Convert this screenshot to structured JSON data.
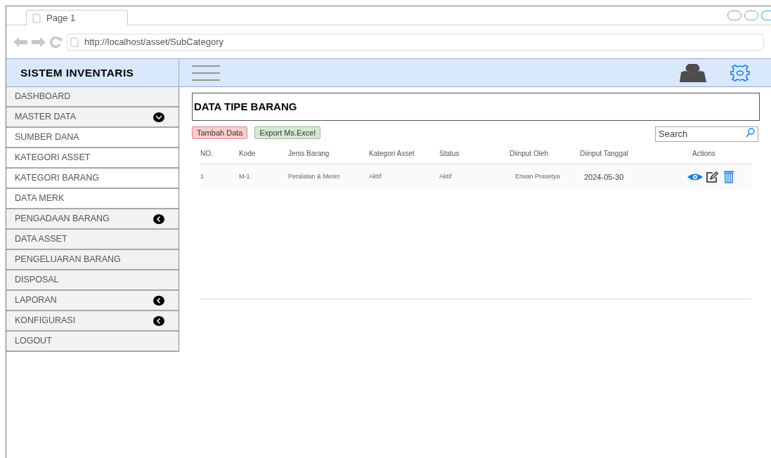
{
  "browser": {
    "tab": "Page 1",
    "url": "http://localhost/asset/SubCategory"
  },
  "app_title": "SISTEM INVENTARIS",
  "sidebar": {
    "items": [
      {
        "label": "DASHBOARD"
      },
      {
        "label": "MASTER DATA",
        "expanded": true,
        "children": [
          {
            "label": "SUMBER DANA"
          },
          {
            "label": "KATEGORI ASSET"
          },
          {
            "label": "KATEGORI BARANG"
          },
          {
            "label": "DATA MERK"
          }
        ]
      },
      {
        "label": "PENGADAAN BARANG",
        "expanded": false
      },
      {
        "label": "DATA ASSET"
      },
      {
        "label": "PENGELUARAN BARANG"
      },
      {
        "label": "DISPOSAL"
      },
      {
        "label": "LAPORAN",
        "expanded": false
      },
      {
        "label": "KONFIGURASI",
        "expanded": false
      },
      {
        "label": "LOGOUT"
      }
    ]
  },
  "page_title": "DATA TIPE BARANG",
  "buttons": [
    {
      "label": "Tambah Data",
      "kind": "add"
    },
    {
      "label": "Export Ms.Excel",
      "kind": "export"
    }
  ],
  "search": {
    "placeholder": "Search"
  },
  "table": {
    "columns": [
      "NO.",
      "Kode",
      "Jenis Barang",
      "Kategori Asset",
      "Status",
      "Diinput Oleh",
      "Diinput Tanggal",
      "Actions"
    ],
    "rows": [
      [
        "1",
        "M-1",
        "Peralatan & Mesin",
        "Aktif",
        "Aktif",
        "Erwan Prasetya",
        "2024-05-30"
      ]
    ]
  }
}
